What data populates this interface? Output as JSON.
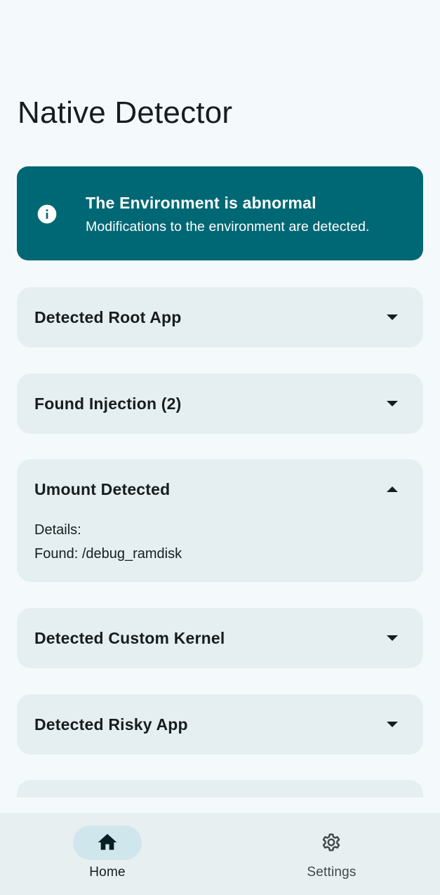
{
  "app": {
    "title": "Native Detector"
  },
  "status": {
    "title": "The Environment is abnormal",
    "description": "Modifications to the environment are detected.",
    "icon": "info-icon",
    "color": "#006874"
  },
  "panels": [
    {
      "title": "Detected Root App",
      "expanded": false
    },
    {
      "title": "Found Injection (2)",
      "expanded": false
    },
    {
      "title": "Umount Detected",
      "expanded": true,
      "details_label": "Details:",
      "details_value": "Found: /debug_ramdisk"
    },
    {
      "title": "Detected Custom Kernel",
      "expanded": false
    },
    {
      "title": "Detected Risky App",
      "expanded": false
    }
  ],
  "nav": {
    "items": [
      {
        "label": "Home",
        "icon": "home-icon",
        "selected": true
      },
      {
        "label": "Settings",
        "icon": "gear-icon",
        "selected": false
      }
    ]
  }
}
